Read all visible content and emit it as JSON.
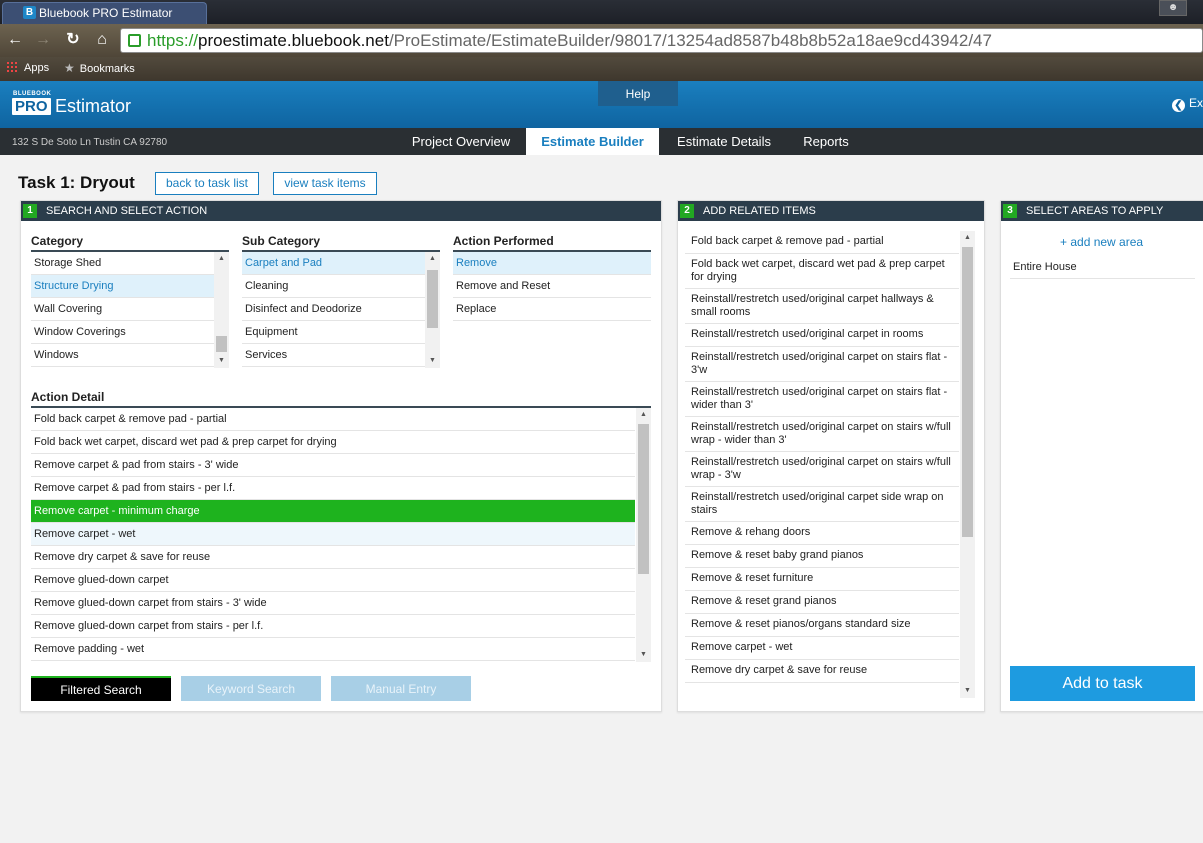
{
  "browser": {
    "tab_title": "Bluebook PRO Estimator",
    "url_scheme": "https://",
    "url_host": "proestimate.bluebook.net",
    "url_path": "/ProEstimate/EstimateBuilder/98017/13254ad8587b48b8b52a18ae9cd43942/47",
    "bookmarks": [
      "Apps",
      "Bookmarks"
    ]
  },
  "app": {
    "logo_small": "BLUEBOOK",
    "logo_pro": "PRO",
    "logo_name": "Estimator",
    "help_label": "Help",
    "exit_label": "Ex",
    "address": "132 S De Soto Ln Tustin CA 92780",
    "nav_tabs": [
      "Project Overview",
      "Estimate Builder",
      "Estimate Details",
      "Reports"
    ]
  },
  "task": {
    "title": "Task 1: Dryout",
    "back_label": "back to task list",
    "view_label": "view task items"
  },
  "panel1": {
    "step": "1",
    "title": "SEARCH AND SELECT ACTION",
    "category_title": "Category",
    "categories": [
      "Storage Shed",
      "Structure Drying",
      "Wall Covering",
      "Window Coverings",
      "Windows"
    ],
    "subcategory_title": "Sub Category",
    "subcategories": [
      "Carpet and Pad",
      "Cleaning",
      "Disinfect and Deodorize",
      "Equipment",
      "Services"
    ],
    "action_title": "Action Performed",
    "actions": [
      "Remove",
      "Remove and Reset",
      "Replace"
    ],
    "detail_title": "Action Detail",
    "details": [
      "Fold back carpet & remove pad - partial",
      "Fold back wet carpet, discard wet pad & prep carpet for drying",
      "Remove carpet & pad from stairs - 3' wide",
      "Remove carpet & pad from stairs - per l.f.",
      "Remove carpet - minimum charge",
      "Remove carpet - wet",
      "Remove dry carpet & save for reuse",
      "Remove glued-down carpet",
      "Remove glued-down carpet from stairs - 3' wide",
      "Remove glued-down carpet from stairs - per l.f.",
      "Remove padding - wet"
    ],
    "search_tabs": [
      "Filtered Search",
      "Keyword Search",
      "Manual Entry"
    ]
  },
  "panel2": {
    "step": "2",
    "title": "ADD RELATED ITEMS",
    "items": [
      "Fold back carpet & remove pad - partial",
      "Fold back wet carpet, discard wet pad & prep carpet for drying",
      "Reinstall/restretch used/original carpet hallways & small rooms",
      "Reinstall/restretch used/original carpet in rooms",
      "Reinstall/restretch used/original carpet on stairs flat - 3'w",
      "Reinstall/restretch used/original carpet on stairs flat - wider than 3'",
      "Reinstall/restretch used/original carpet on stairs w/full wrap - wider than 3'",
      "Reinstall/restretch used/original carpet on stairs w/full wrap - 3'w",
      "Reinstall/restretch used/original carpet side wrap on stairs",
      "Remove & rehang doors",
      "Remove & reset baby grand pianos",
      "Remove & reset furniture",
      "Remove & reset grand pianos",
      "Remove & reset pianos/organs standard size",
      "Remove carpet - wet",
      "Remove dry carpet & save for reuse"
    ]
  },
  "panel3": {
    "step": "3",
    "title": "SELECT AREAS TO APPLY",
    "add_area": "+ add new area",
    "areas": [
      "Entire House"
    ],
    "add_to_task": "Add to task"
  },
  "colors": {
    "header_blue": "#1a7fbf",
    "panel_head": "#2b3d4b",
    "selected_green": "#1eb31e",
    "add_button": "#1e9be0"
  }
}
